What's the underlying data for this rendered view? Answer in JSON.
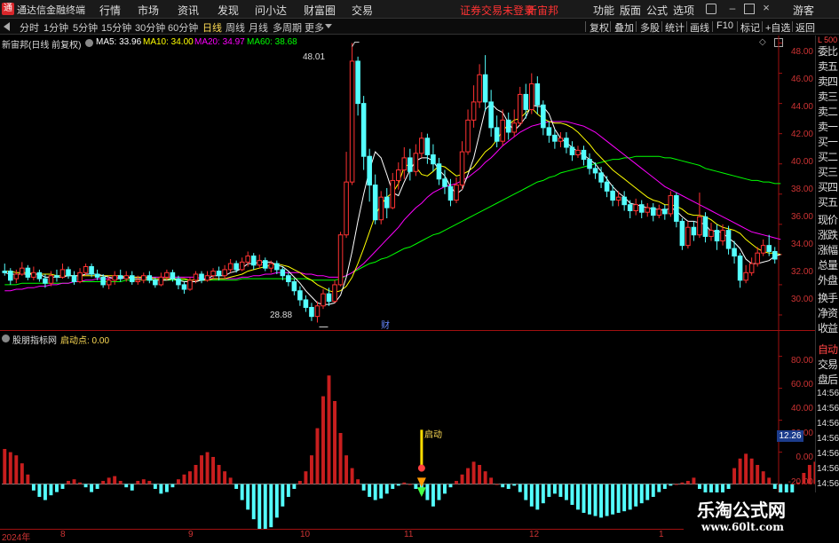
{
  "menubar": {
    "app_title": "通达信金融终端",
    "logo_char": "通",
    "menus": [
      "行情",
      "市场",
      "资讯",
      "发现",
      "问小达",
      "财富圈",
      "交易"
    ],
    "notice": "证券交易未登录",
    "stock": "新宙邦",
    "right_menus": [
      "功能",
      "版面",
      "公式",
      "选项"
    ],
    "guest": "游客"
  },
  "periodbar": {
    "periods": [
      "分时",
      "1分钟",
      "5分钟",
      "15分钟",
      "30分钟",
      "60分钟",
      "日线",
      "周线",
      "月线",
      "多周期",
      "更多"
    ],
    "active": "日线",
    "tools": [
      "复权",
      "叠加",
      "多股",
      "统计",
      "画线",
      "F10",
      "标记",
      "+自选",
      "返回"
    ]
  },
  "infobar": {
    "stock_title": "新宙邦(日线 前复权)",
    "ma5": "MA5: 33.96",
    "ma10": "MA10: 34.00",
    "ma20": "MA20: 34.97",
    "ma60": "MA60: 38.68"
  },
  "colors": {
    "up": "#ff3232",
    "down": "#54ffff",
    "ma5": "#ffffff",
    "ma10": "#ffff00",
    "ma20": "#ff00ff",
    "ma60": "#00ff00",
    "grid": "#a01010"
  },
  "sidebar": {
    "corner": "L 500",
    "items": [
      "委比",
      "卖五",
      "卖四",
      "卖三",
      "卖二",
      "卖一",
      "买一",
      "买二",
      "买三",
      "买四",
      "买五",
      "现价",
      "涨跌",
      "涨幅",
      "总量",
      "外盘",
      "换手",
      "净资",
      "收益"
    ],
    "lower_items": [
      "自动",
      "交易",
      "盘后"
    ]
  },
  "price_axis": [
    "48.00",
    "46.00",
    "44.00",
    "42.00",
    "40.00",
    "38.00",
    "36.00",
    "34.00",
    "32.00",
    "30.00"
  ],
  "annotations": {
    "high": "48.01",
    "low": "28.88",
    "cai": "财"
  },
  "indicator": {
    "name": "股朋指标网",
    "param": "启动点: 0.00",
    "axis": [
      "80.00",
      "60.00",
      "40.00",
      "20.00",
      "0.00",
      "-20.00"
    ],
    "marker_text": "启动",
    "current": "12.26"
  },
  "time_ticks": [
    "14:56",
    "14:56",
    "14:56",
    "14:56",
    "14:56",
    "14:56",
    "14:56"
  ],
  "dates": [
    "2024年",
    "8",
    "9",
    "10",
    "11",
    "12",
    "1"
  ],
  "watermark": {
    "line1": "乐淘公式网",
    "line2": "www.60lt.com"
  },
  "chart_data": {
    "type": "candlestick",
    "ylim": [
      29.0,
      48.5
    ],
    "candles": [
      [
        32.9,
        32.8,
        32.6,
        33.4
      ],
      [
        32.9,
        32.3,
        32.0,
        33.1
      ],
      [
        32.4,
        32.7,
        32.1,
        33.0
      ],
      [
        32.7,
        33.1,
        32.6,
        33.5
      ],
      [
        33.1,
        32.5,
        32.3,
        33.3
      ],
      [
        32.5,
        32.8,
        32.3,
        33.2
      ],
      [
        32.8,
        32.4,
        32.2,
        33.0
      ],
      [
        32.4,
        32.1,
        31.8,
        32.7
      ],
      [
        32.1,
        32.6,
        31.9,
        32.9
      ],
      [
        32.6,
        32.5,
        32.2,
        33.0
      ],
      [
        32.5,
        33.0,
        32.4,
        33.4
      ],
      [
        33.0,
        32.6,
        32.4,
        33.2
      ],
      [
        32.6,
        32.2,
        32.0,
        32.9
      ],
      [
        32.2,
        32.8,
        32.1,
        33.1
      ],
      [
        32.8,
        33.2,
        32.6,
        33.4
      ],
      [
        33.2,
        32.7,
        32.5,
        33.4
      ],
      [
        32.7,
        32.5,
        32.3,
        33.0
      ],
      [
        32.5,
        32.0,
        31.8,
        32.7
      ],
      [
        32.0,
        32.3,
        31.7,
        32.6
      ],
      [
        32.3,
        32.6,
        32.0,
        32.9
      ],
      [
        32.6,
        32.4,
        32.2,
        33.0
      ],
      [
        32.4,
        32.6,
        32.2,
        32.9
      ],
      [
        32.6,
        32.2,
        32.0,
        32.9
      ],
      [
        32.2,
        32.3,
        32.0,
        32.6
      ],
      [
        32.3,
        32.6,
        32.1,
        32.8
      ],
      [
        32.6,
        32.3,
        32.1,
        32.9
      ],
      [
        32.3,
        32.0,
        31.8,
        32.5
      ],
      [
        32.0,
        32.5,
        31.9,
        32.8
      ],
      [
        32.5,
        32.8,
        32.3,
        33.0
      ],
      [
        32.8,
        32.4,
        32.2,
        33.0
      ],
      [
        32.4,
        32.0,
        31.7,
        32.6
      ],
      [
        32.0,
        31.7,
        31.4,
        32.2
      ],
      [
        31.7,
        32.3,
        31.6,
        32.5
      ],
      [
        32.3,
        32.7,
        32.1,
        32.9
      ],
      [
        32.7,
        32.3,
        32.1,
        32.9
      ],
      [
        32.3,
        32.6,
        32.2,
        32.9
      ],
      [
        32.6,
        32.9,
        32.4,
        33.1
      ],
      [
        32.9,
        32.6,
        32.3,
        33.2
      ],
      [
        32.6,
        33.0,
        32.4,
        33.3
      ],
      [
        33.0,
        33.4,
        32.8,
        33.7
      ],
      [
        33.4,
        33.0,
        32.8,
        33.6
      ],
      [
        33.0,
        33.5,
        32.9,
        33.8
      ],
      [
        33.5,
        33.9,
        33.2,
        34.2
      ],
      [
        33.9,
        33.3,
        33.0,
        34.1
      ],
      [
        33.3,
        33.6,
        33.1,
        34.0
      ],
      [
        33.6,
        33.1,
        32.9,
        33.8
      ],
      [
        33.1,
        33.4,
        32.8,
        33.6
      ],
      [
        33.4,
        33.0,
        32.7,
        33.6
      ],
      [
        33.0,
        32.6,
        32.3,
        33.2
      ],
      [
        32.6,
        32.2,
        31.9,
        32.8
      ],
      [
        32.2,
        31.6,
        31.3,
        32.4
      ],
      [
        31.6,
        31.0,
        30.6,
        31.9
      ],
      [
        31.0,
        30.5,
        30.2,
        31.3
      ],
      [
        30.5,
        29.9,
        29.6,
        30.8
      ],
      [
        29.9,
        30.6,
        29.5,
        30.9
      ],
      [
        30.6,
        31.4,
        30.4,
        31.7
      ],
      [
        31.4,
        30.9,
        30.6,
        31.8
      ],
      [
        30.9,
        32.0,
        30.8,
        32.3
      ],
      [
        32.0,
        35.3,
        31.9,
        35.5
      ],
      [
        35.3,
        38.8,
        35.1,
        40.8
      ],
      [
        38.8,
        46.8,
        38.6,
        48.0
      ],
      [
        46.8,
        44.0,
        43.2,
        47.1
      ],
      [
        44.0,
        40.5,
        39.6,
        44.5
      ],
      [
        40.5,
        38.6,
        37.5,
        41.0
      ],
      [
        38.6,
        36.3,
        36.0,
        39.3
      ],
      [
        36.3,
        37.8,
        36.0,
        38.2
      ],
      [
        37.8,
        37.1,
        36.4,
        38.4
      ],
      [
        37.1,
        38.9,
        37.0,
        39.4
      ],
      [
        38.9,
        39.6,
        38.3,
        40.1
      ],
      [
        39.6,
        40.4,
        39.0,
        41.1
      ],
      [
        40.4,
        39.5,
        38.9,
        41.0
      ],
      [
        39.5,
        40.7,
        39.2,
        41.3
      ],
      [
        40.7,
        41.7,
        40.4,
        42.1
      ],
      [
        41.7,
        40.6,
        40.0,
        42.0
      ],
      [
        40.6,
        40.0,
        39.5,
        41.3
      ],
      [
        40.0,
        39.0,
        38.6,
        40.4
      ],
      [
        39.0,
        38.5,
        38.0,
        39.6
      ],
      [
        38.5,
        37.6,
        37.2,
        39.0
      ],
      [
        37.6,
        38.6,
        37.4,
        39.1
      ],
      [
        38.6,
        40.8,
        38.3,
        41.5
      ],
      [
        40.8,
        42.9,
        40.6,
        43.6
      ],
      [
        42.9,
        44.1,
        42.4,
        45.2
      ],
      [
        44.1,
        45.9,
        43.7,
        46.6
      ],
      [
        45.9,
        44.1,
        43.5,
        47.2
      ],
      [
        44.1,
        42.4,
        41.8,
        44.9
      ],
      [
        42.4,
        41.5,
        41.1,
        43.2
      ],
      [
        41.5,
        42.9,
        41.2,
        43.6
      ],
      [
        42.9,
        42.1,
        41.6,
        43.4
      ],
      [
        42.1,
        42.7,
        41.8,
        43.6
      ],
      [
        42.7,
        44.6,
        42.5,
        45.1
      ],
      [
        44.6,
        43.6,
        43.0,
        45.3
      ],
      [
        43.6,
        45.3,
        43.3,
        46.0
      ],
      [
        45.3,
        43.9,
        43.3,
        45.8
      ],
      [
        43.9,
        42.4,
        41.9,
        44.2
      ],
      [
        42.4,
        41.9,
        41.4,
        42.8
      ],
      [
        41.9,
        41.5,
        41.0,
        42.3
      ],
      [
        41.5,
        41.7,
        41.1,
        42.1
      ],
      [
        41.7,
        41.1,
        40.7,
        42.1
      ],
      [
        41.1,
        40.6,
        40.2,
        41.5
      ],
      [
        40.6,
        40.9,
        40.4,
        41.2
      ],
      [
        40.9,
        40.3,
        39.9,
        41.2
      ],
      [
        40.3,
        39.7,
        39.3,
        40.7
      ],
      [
        39.7,
        39.4,
        39.0,
        40.1
      ],
      [
        39.4,
        38.8,
        38.4,
        39.8
      ],
      [
        38.8,
        38.2,
        37.8,
        39.2
      ],
      [
        38.2,
        37.6,
        37.2,
        38.6
      ],
      [
        37.6,
        37.8,
        37.2,
        38.2
      ],
      [
        37.8,
        37.3,
        36.9,
        38.2
      ],
      [
        37.3,
        36.9,
        36.4,
        37.6
      ],
      [
        36.9,
        37.3,
        36.6,
        37.7
      ],
      [
        37.3,
        36.8,
        36.4,
        37.6
      ],
      [
        36.8,
        37.1,
        36.5,
        37.4
      ],
      [
        37.1,
        36.6,
        36.2,
        37.4
      ],
      [
        36.6,
        37.0,
        36.4,
        37.3
      ],
      [
        37.0,
        36.7,
        36.3,
        37.3
      ],
      [
        36.7,
        37.9,
        36.5,
        38.2
      ],
      [
        37.9,
        36.2,
        35.8,
        38.1
      ],
      [
        36.2,
        34.6,
        34.3,
        36.4
      ],
      [
        34.6,
        35.8,
        34.4,
        36.2
      ],
      [
        35.8,
        35.3,
        34.9,
        36.2
      ],
      [
        35.3,
        36.5,
        35.1,
        38.1
      ],
      [
        36.5,
        35.2,
        34.8,
        36.8
      ],
      [
        35.2,
        35.6,
        34.9,
        36.1
      ],
      [
        35.6,
        34.9,
        34.3,
        36.0
      ],
      [
        34.9,
        35.6,
        34.6,
        36.0
      ],
      [
        35.6,
        34.4,
        34.0,
        35.9
      ],
      [
        34.4,
        33.9,
        33.4,
        34.9
      ],
      [
        33.9,
        32.3,
        31.8,
        34.1
      ],
      [
        32.3,
        32.8,
        32.1,
        33.3
      ],
      [
        32.8,
        33.4,
        32.6,
        33.8
      ],
      [
        33.4,
        34.1,
        33.2,
        34.5
      ],
      [
        34.1,
        34.6,
        33.9,
        35.0
      ],
      [
        34.6,
        34.2,
        33.9,
        35.3
      ],
      [
        34.2,
        33.7,
        33.4,
        34.5
      ]
    ],
    "ma5": [
      32.8,
      32.7,
      32.7,
      32.7,
      32.7,
      32.7,
      32.7,
      32.5,
      32.5,
      32.5,
      32.5,
      32.6,
      32.6,
      32.6,
      32.7,
      32.7,
      32.7,
      32.6,
      32.5,
      32.4,
      32.4,
      32.5,
      32.4,
      32.4,
      32.4,
      32.4,
      32.3,
      32.3,
      32.3,
      32.4,
      32.3,
      32.2,
      32.2,
      32.2,
      32.3,
      32.4,
      32.6,
      32.6,
      32.6,
      32.8,
      32.9,
      33.1,
      33.4,
      33.4,
      33.5,
      33.5,
      33.5,
      33.3,
      33.2,
      32.9,
      32.5,
      32.1,
      31.6,
      31.2,
      30.8,
      30.7,
      30.7,
      30.8,
      31.3,
      32.5,
      34.2,
      36.2,
      38.0,
      39.6,
      40.8,
      40.4,
      39.3,
      38.1,
      37.9,
      38.8,
      39.6,
      40.2,
      40.4,
      40.4,
      40.2,
      39.6,
      39.2,
      38.5,
      38.0,
      38.3,
      39.3,
      40.4,
      42.0,
      43.6,
      44.0,
      43.6,
      43.4,
      42.7,
      42.2,
      42.6,
      43.1,
      43.9,
      43.8,
      43.8,
      43.3,
      42.3,
      41.7,
      41.4,
      41.1,
      40.8,
      40.6,
      40.3,
      40.0,
      39.5,
      39.0,
      38.5,
      38.1,
      37.8,
      37.4,
      37.3,
      37.2,
      37.1,
      37.0,
      37.0,
      36.9,
      37.1,
      36.9,
      36.5,
      36.2,
      36.2,
      36.1,
      36.0,
      35.5,
      35.6,
      35.4,
      35.1,
      34.8,
      34.4,
      33.7,
      33.4,
      33.4,
      33.5,
      33.6,
      33.9,
      34.0
    ],
    "ma10": [
      32.9,
      32.9,
      32.8,
      32.8,
      32.8,
      32.7,
      32.7,
      32.7,
      32.7,
      32.6,
      32.6,
      32.6,
      32.6,
      32.6,
      32.6,
      32.6,
      32.6,
      32.6,
      32.6,
      32.6,
      32.6,
      32.5,
      32.5,
      32.5,
      32.5,
      32.5,
      32.4,
      32.4,
      32.4,
      32.4,
      32.4,
      32.4,
      32.3,
      32.3,
      32.3,
      32.3,
      32.4,
      32.4,
      32.4,
      32.5,
      32.6,
      32.7,
      32.9,
      33.0,
      33.1,
      33.2,
      33.3,
      33.4,
      33.3,
      33.2,
      33.0,
      32.8,
      32.5,
      32.3,
      32.0,
      31.8,
      31.6,
      31.5,
      31.6,
      31.9,
      32.5,
      33.4,
      34.4,
      35.5,
      36.6,
      37.3,
      37.8,
      38.1,
      38.7,
      39.8,
      40.0,
      39.8,
      39.3,
      39.2,
      39.5,
      39.9,
      39.8,
      39.5,
      39.2,
      39.3,
      39.5,
      39.8,
      40.3,
      40.8,
      41.1,
      41.6,
      42.2,
      42.6,
      42.9,
      43.0,
      43.4,
      43.7,
      43.3,
      43.0,
      42.8,
      42.7,
      42.7,
      42.6,
      42.4,
      42.1,
      41.7,
      41.3,
      40.8,
      40.4,
      40.0,
      39.6,
      39.3,
      39.0,
      38.7,
      38.4,
      38.1,
      37.8,
      37.6,
      37.5,
      37.3,
      37.3,
      37.2,
      37.0,
      36.7,
      36.6,
      36.6,
      36.5,
      36.3,
      36.0,
      35.8,
      35.7,
      35.6,
      35.4,
      35.0,
      34.7,
      34.4,
      34.2,
      34.1,
      34.1,
      34.0
    ],
    "ma20": [
      31.6,
      31.6,
      31.7,
      31.7,
      31.8,
      31.8,
      31.9,
      31.9,
      32.0,
      32.0,
      32.1,
      32.1,
      32.2,
      32.2,
      32.3,
      32.3,
      32.4,
      32.4,
      32.4,
      32.5,
      32.5,
      32.5,
      32.5,
      32.5,
      32.5,
      32.5,
      32.5,
      32.5,
      32.5,
      32.5,
      32.5,
      32.5,
      32.5,
      32.5,
      32.4,
      32.4,
      32.4,
      32.4,
      32.4,
      32.4,
      32.4,
      32.5,
      32.5,
      32.6,
      32.6,
      32.7,
      32.7,
      32.8,
      32.8,
      32.8,
      32.8,
      32.8,
      32.7,
      32.7,
      32.6,
      32.6,
      32.5,
      32.5,
      32.5,
      32.6,
      32.8,
      33.1,
      33.4,
      33.8,
      34.2,
      34.6,
      35.0,
      35.4,
      35.8,
      36.3,
      36.7,
      37.1,
      37.4,
      37.8,
      38.1,
      38.3,
      38.5,
      38.6,
      38.7,
      38.9,
      39.1,
      39.4,
      39.7,
      40.1,
      40.4,
      40.8,
      41.2,
      41.5,
      41.8,
      42.1,
      42.3,
      42.5,
      42.6,
      42.7,
      42.8,
      42.8,
      42.8,
      42.8,
      42.7,
      42.6,
      42.5,
      42.3,
      42.1,
      41.8,
      41.5,
      41.2,
      40.9,
      40.6,
      40.3,
      40.0,
      39.7,
      39.4,
      39.1,
      38.8,
      38.5,
      38.3,
      38.1,
      37.9,
      37.7,
      37.5,
      37.3,
      37.1,
      36.9,
      36.7,
      36.5,
      36.3,
      36.1,
      35.9,
      35.7,
      35.5,
      35.4,
      35.3,
      35.2,
      35.1,
      35.0
    ],
    "ma60": [
      32.0,
      32.0,
      32.0,
      32.1,
      32.1,
      32.1,
      32.1,
      32.1,
      32.1,
      32.1,
      32.1,
      32.1,
      32.2,
      32.2,
      32.2,
      32.2,
      32.2,
      32.2,
      32.2,
      32.2,
      32.2,
      32.3,
      32.3,
      32.3,
      32.3,
      32.3,
      32.3,
      32.3,
      32.3,
      32.3,
      32.3,
      32.3,
      32.3,
      32.3,
      32.3,
      32.3,
      32.3,
      32.3,
      32.3,
      32.3,
      32.3,
      32.4,
      32.4,
      32.4,
      32.4,
      32.4,
      32.4,
      32.4,
      32.4,
      32.4,
      32.4,
      32.4,
      32.4,
      32.3,
      32.3,
      32.3,
      32.3,
      32.3,
      32.4,
      32.6,
      32.8,
      33.0,
      33.2,
      33.4,
      33.5,
      33.7,
      33.8,
      34.0,
      34.2,
      34.4,
      34.5,
      34.7,
      34.9,
      35.1,
      35.3,
      35.4,
      35.6,
      35.8,
      36.0,
      36.2,
      36.4,
      36.6,
      36.8,
      37.0,
      37.2,
      37.4,
      37.6,
      37.8,
      38.0,
      38.2,
      38.4,
      38.6,
      38.8,
      38.9,
      39.1,
      39.2,
      39.4,
      39.5,
      39.6,
      39.7,
      39.8,
      39.9,
      40.0,
      40.1,
      40.2,
      40.3,
      40.3,
      40.4,
      40.4,
      40.5,
      40.5,
      40.5,
      40.5,
      40.5,
      40.4,
      40.4,
      40.3,
      40.2,
      40.1,
      40.0,
      39.9,
      39.7,
      39.6,
      39.5,
      39.4,
      39.3,
      39.2,
      39.1,
      39.0,
      38.9,
      38.9,
      38.8,
      38.8,
      38.7,
      38.7
    ],
    "indicator_ylim": [
      -28,
      92
    ],
    "indicator_bars": [
      22,
      20,
      18,
      13,
      6,
      -4,
      -8,
      -10,
      -7,
      -5,
      -3,
      2,
      3,
      1,
      -2,
      -5,
      -3,
      2,
      4,
      5,
      2,
      -2,
      -4,
      2,
      3,
      2,
      -3,
      -6,
      -5,
      -2,
      3,
      6,
      8,
      12,
      18,
      20,
      17,
      12,
      8,
      4,
      -3,
      -10,
      -16,
      -22,
      -28,
      -30,
      -27,
      -21,
      -14,
      -8,
      -3,
      2,
      8,
      18,
      35,
      55,
      68,
      52,
      32,
      18,
      10,
      3,
      -4,
      -8,
      -10,
      -9,
      -6,
      -3,
      -1,
      1,
      0,
      -3,
      -6,
      -10,
      -14,
      -10,
      -6,
      -2,
      2,
      6,
      10,
      14,
      12,
      8,
      4,
      0,
      -2,
      -3,
      -1,
      -5,
      -10,
      -14,
      -16,
      -12,
      -8,
      -6,
      -8,
      -10,
      -13,
      -16,
      -18,
      -19,
      -20,
      -21,
      -20,
      -19,
      -18,
      -17,
      -16,
      -14,
      -12,
      -10,
      -8,
      -5,
      -3,
      -1,
      0,
      1,
      2,
      4,
      -3,
      -8,
      -11,
      -12,
      -8,
      -3,
      10,
      16,
      19,
      16,
      12,
      8,
      4,
      -3,
      -8,
      -11,
      -6,
      1,
      7,
      12,
      14,
      12,
      9,
      5
    ]
  }
}
